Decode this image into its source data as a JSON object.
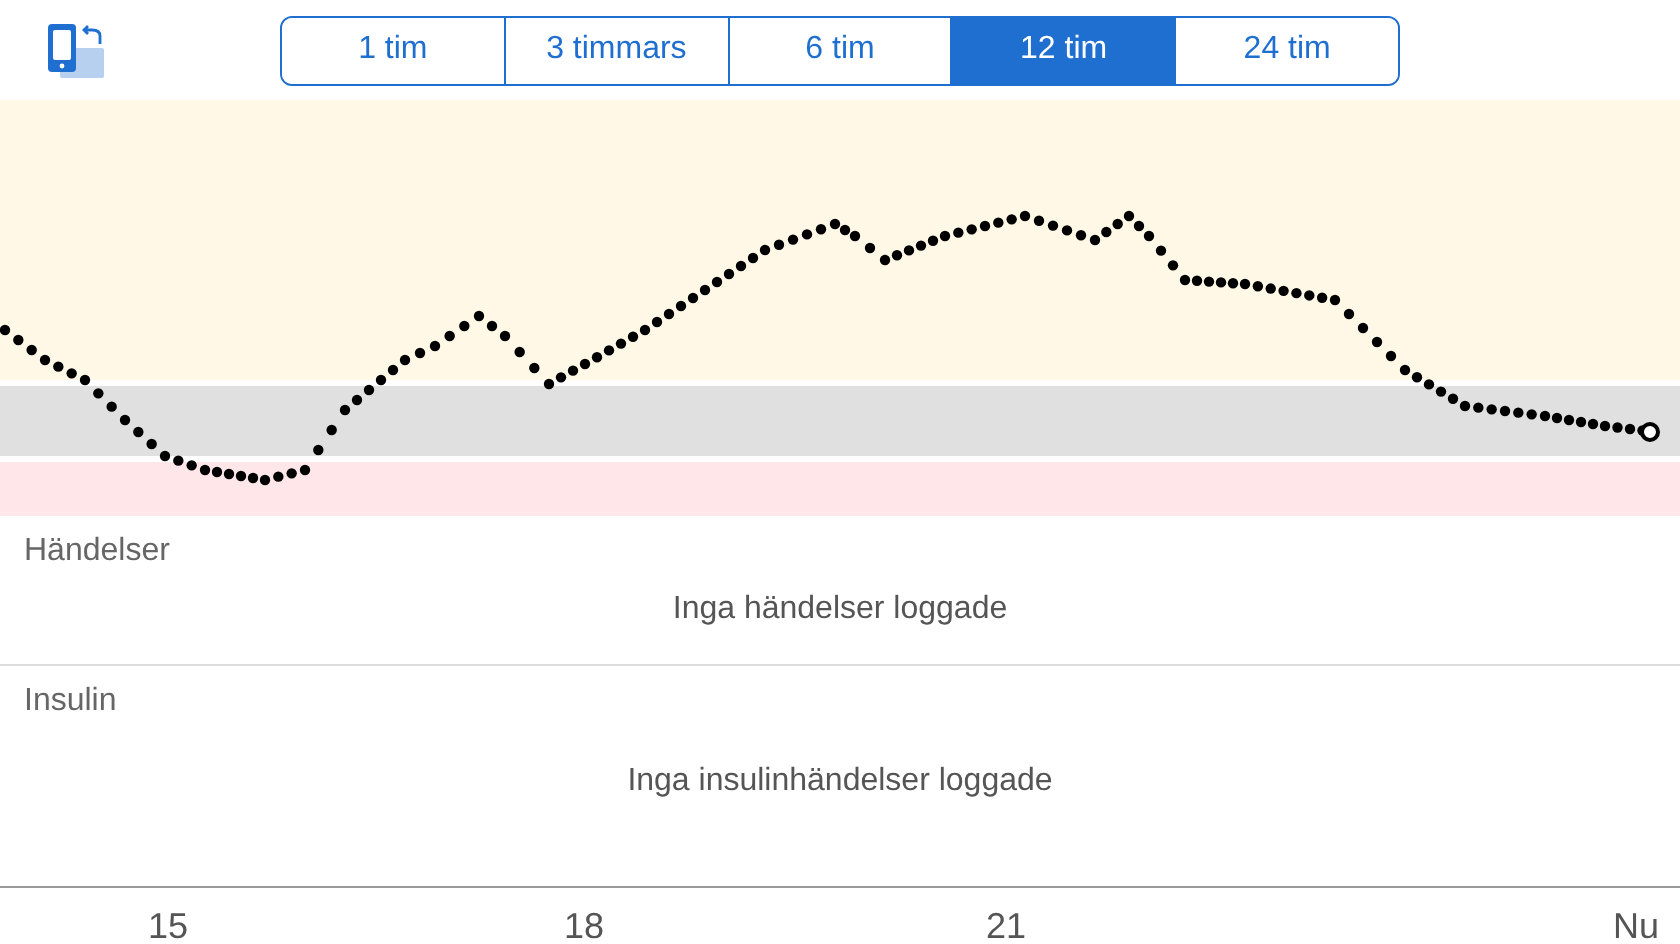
{
  "time_ranges": [
    {
      "label": "1 tim",
      "selected": false
    },
    {
      "label": "3 timmars",
      "selected": false
    },
    {
      "label": "6 tim",
      "selected": false
    },
    {
      "label": "12 tim",
      "selected": true
    },
    {
      "label": "24 tim",
      "selected": false
    }
  ],
  "sections": [
    {
      "title": "Händelser",
      "empty_message": "Inga händelser loggade"
    },
    {
      "title": "Insulin",
      "empty_message": "Inga insulinhändelser loggade"
    }
  ],
  "time_axis": {
    "labels": [
      "15",
      "18",
      "21",
      "Nu"
    ]
  }
}
